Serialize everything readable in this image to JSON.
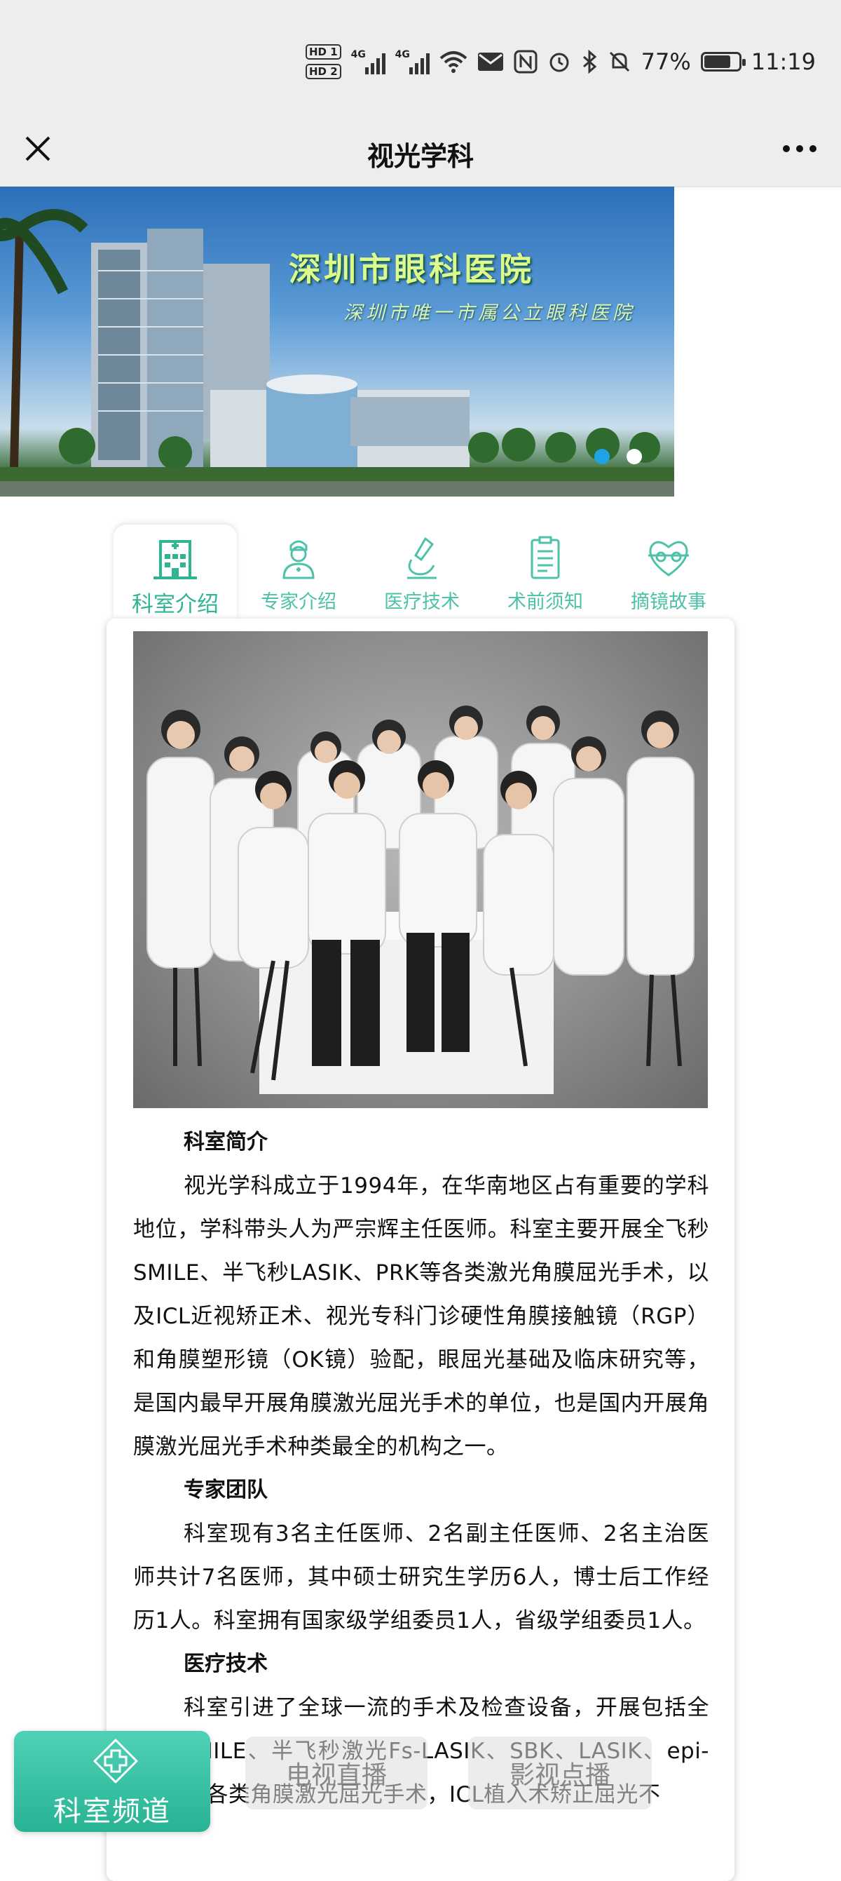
{
  "status_bar": {
    "hd1": "HD 1",
    "hd2": "HD 2",
    "sig1": "4G",
    "sig2": "4G",
    "battery_percent": "77%",
    "time": "11:19"
  },
  "nav": {
    "title": "视光学科"
  },
  "banner": {
    "title": "深圳市眼科医院",
    "subtitle": "深圳市唯一市属公立眼科医院",
    "slide_count": 2,
    "active_slide": 0
  },
  "tabs": [
    {
      "label": "科室介绍",
      "icon": "building-icon",
      "active": true
    },
    {
      "label": "专家介绍",
      "icon": "doctor-icon",
      "active": false
    },
    {
      "label": "医疗技术",
      "icon": "microscope-icon",
      "active": false
    },
    {
      "label": "术前须知",
      "icon": "clipboard-icon",
      "active": false
    },
    {
      "label": "摘镜故事",
      "icon": "heart-glasses-icon",
      "active": false
    }
  ],
  "article": {
    "sections": [
      {
        "heading": "科室简介",
        "body": "视光学科成立于1994年，在华南地区占有重要的学科地位，学科带头人为严宗辉主任医师。科室主要开展全飞秒SMILE、半飞秒LASIK、PRK等各类激光角膜屈光手术，以及ICL近视矫正术、视光专科门诊硬性角膜接触镜（RGP）和角膜塑形镜（OK镜）验配，眼屈光基础及临床研究等，是国内最早开展角膜激光屈光手术的单位，也是国内开展角膜激光屈光手术种类最全的机构之一。"
      },
      {
        "heading": "专家团队",
        "body": "科室现有3名主任医师、2名副主任医师、2名主治医师共计7名医师，其中硕士研究生学历6人，博士后工作经历1人。科室拥有国家级学组委员1人，省级学组委员1人。"
      },
      {
        "heading": "医疗技术",
        "body": "科室引进了全球一流的手术及检查设备，开展包括全飞秒SMILE、半飞秒激光Fs-LASIK、SBK、LASIK、epi-lasik等各类角膜激光屈光手术，ICL植入术矫正屈光不"
      }
    ]
  },
  "floating": {
    "channel_label": "科室频道",
    "tv_live": "电视直播",
    "vod": "影视点播"
  },
  "colors": {
    "accent": "#2fb594",
    "chrome": "#ededed"
  }
}
